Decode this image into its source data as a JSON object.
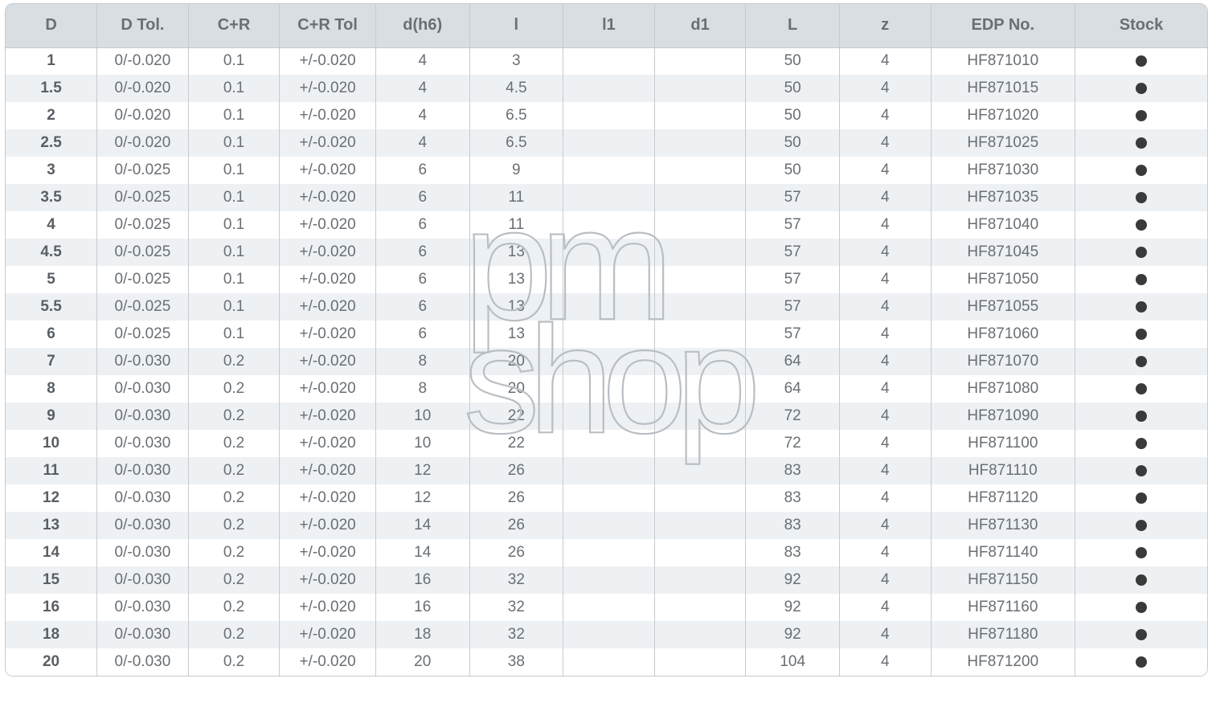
{
  "watermark": {
    "line1": "pm",
    "line2": "shop"
  },
  "table": {
    "headers": [
      "D",
      "D Tol.",
      "C+R",
      "C+R Tol",
      "d(h6)",
      "l",
      "l1",
      "d1",
      "L",
      "z",
      "EDP No.",
      "Stock"
    ],
    "rows": [
      {
        "D": "1",
        "DTol": "0/-0.020",
        "CR": "0.1",
        "CRTol": "+/-0.020",
        "dh6": "4",
        "l": "3",
        "l1": "",
        "d1": "",
        "L": "50",
        "z": "4",
        "EDP": "HF871010",
        "Stock": true
      },
      {
        "D": "1.5",
        "DTol": "0/-0.020",
        "CR": "0.1",
        "CRTol": "+/-0.020",
        "dh6": "4",
        "l": "4.5",
        "l1": "",
        "d1": "",
        "L": "50",
        "z": "4",
        "EDP": "HF871015",
        "Stock": true
      },
      {
        "D": "2",
        "DTol": "0/-0.020",
        "CR": "0.1",
        "CRTol": "+/-0.020",
        "dh6": "4",
        "l": "6.5",
        "l1": "",
        "d1": "",
        "L": "50",
        "z": "4",
        "EDP": "HF871020",
        "Stock": true
      },
      {
        "D": "2.5",
        "DTol": "0/-0.020",
        "CR": "0.1",
        "CRTol": "+/-0.020",
        "dh6": "4",
        "l": "6.5",
        "l1": "",
        "d1": "",
        "L": "50",
        "z": "4",
        "EDP": "HF871025",
        "Stock": true
      },
      {
        "D": "3",
        "DTol": "0/-0.025",
        "CR": "0.1",
        "CRTol": "+/-0.020",
        "dh6": "6",
        "l": "9",
        "l1": "",
        "d1": "",
        "L": "50",
        "z": "4",
        "EDP": "HF871030",
        "Stock": true
      },
      {
        "D": "3.5",
        "DTol": "0/-0.025",
        "CR": "0.1",
        "CRTol": "+/-0.020",
        "dh6": "6",
        "l": "11",
        "l1": "",
        "d1": "",
        "L": "57",
        "z": "4",
        "EDP": "HF871035",
        "Stock": true
      },
      {
        "D": "4",
        "DTol": "0/-0.025",
        "CR": "0.1",
        "CRTol": "+/-0.020",
        "dh6": "6",
        "l": "11",
        "l1": "",
        "d1": "",
        "L": "57",
        "z": "4",
        "EDP": "HF871040",
        "Stock": true
      },
      {
        "D": "4.5",
        "DTol": "0/-0.025",
        "CR": "0.1",
        "CRTol": "+/-0.020",
        "dh6": "6",
        "l": "13",
        "l1": "",
        "d1": "",
        "L": "57",
        "z": "4",
        "EDP": "HF871045",
        "Stock": true
      },
      {
        "D": "5",
        "DTol": "0/-0.025",
        "CR": "0.1",
        "CRTol": "+/-0.020",
        "dh6": "6",
        "l": "13",
        "l1": "",
        "d1": "",
        "L": "57",
        "z": "4",
        "EDP": "HF871050",
        "Stock": true
      },
      {
        "D": "5.5",
        "DTol": "0/-0.025",
        "CR": "0.1",
        "CRTol": "+/-0.020",
        "dh6": "6",
        "l": "13",
        "l1": "",
        "d1": "",
        "L": "57",
        "z": "4",
        "EDP": "HF871055",
        "Stock": true
      },
      {
        "D": "6",
        "DTol": "0/-0.025",
        "CR": "0.1",
        "CRTol": "+/-0.020",
        "dh6": "6",
        "l": "13",
        "l1": "",
        "d1": "",
        "L": "57",
        "z": "4",
        "EDP": "HF871060",
        "Stock": true
      },
      {
        "D": "7",
        "DTol": "0/-0.030",
        "CR": "0.2",
        "CRTol": "+/-0.020",
        "dh6": "8",
        "l": "20",
        "l1": "",
        "d1": "",
        "L": "64",
        "z": "4",
        "EDP": "HF871070",
        "Stock": true
      },
      {
        "D": "8",
        "DTol": "0/-0.030",
        "CR": "0.2",
        "CRTol": "+/-0.020",
        "dh6": "8",
        "l": "20",
        "l1": "",
        "d1": "",
        "L": "64",
        "z": "4",
        "EDP": "HF871080",
        "Stock": true
      },
      {
        "D": "9",
        "DTol": "0/-0.030",
        "CR": "0.2",
        "CRTol": "+/-0.020",
        "dh6": "10",
        "l": "22",
        "l1": "",
        "d1": "",
        "L": "72",
        "z": "4",
        "EDP": "HF871090",
        "Stock": true
      },
      {
        "D": "10",
        "DTol": "0/-0.030",
        "CR": "0.2",
        "CRTol": "+/-0.020",
        "dh6": "10",
        "l": "22",
        "l1": "",
        "d1": "",
        "L": "72",
        "z": "4",
        "EDP": "HF871100",
        "Stock": true
      },
      {
        "D": "11",
        "DTol": "0/-0.030",
        "CR": "0.2",
        "CRTol": "+/-0.020",
        "dh6": "12",
        "l": "26",
        "l1": "",
        "d1": "",
        "L": "83",
        "z": "4",
        "EDP": "HF871110",
        "Stock": true
      },
      {
        "D": "12",
        "DTol": "0/-0.030",
        "CR": "0.2",
        "CRTol": "+/-0.020",
        "dh6": "12",
        "l": "26",
        "l1": "",
        "d1": "",
        "L": "83",
        "z": "4",
        "EDP": "HF871120",
        "Stock": true
      },
      {
        "D": "13",
        "DTol": "0/-0.030",
        "CR": "0.2",
        "CRTol": "+/-0.020",
        "dh6": "14",
        "l": "26",
        "l1": "",
        "d1": "",
        "L": "83",
        "z": "4",
        "EDP": "HF871130",
        "Stock": true
      },
      {
        "D": "14",
        "DTol": "0/-0.030",
        "CR": "0.2",
        "CRTol": "+/-0.020",
        "dh6": "14",
        "l": "26",
        "l1": "",
        "d1": "",
        "L": "83",
        "z": "4",
        "EDP": "HF871140",
        "Stock": true
      },
      {
        "D": "15",
        "DTol": "0/-0.030",
        "CR": "0.2",
        "CRTol": "+/-0.020",
        "dh6": "16",
        "l": "32",
        "l1": "",
        "d1": "",
        "L": "92",
        "z": "4",
        "EDP": "HF871150",
        "Stock": true
      },
      {
        "D": "16",
        "DTol": "0/-0.030",
        "CR": "0.2",
        "CRTol": "+/-0.020",
        "dh6": "16",
        "l": "32",
        "l1": "",
        "d1": "",
        "L": "92",
        "z": "4",
        "EDP": "HF871160",
        "Stock": true
      },
      {
        "D": "18",
        "DTol": "0/-0.030",
        "CR": "0.2",
        "CRTol": "+/-0.020",
        "dh6": "18",
        "l": "32",
        "l1": "",
        "d1": "",
        "L": "92",
        "z": "4",
        "EDP": "HF871180",
        "Stock": true
      },
      {
        "D": "20",
        "DTol": "0/-0.030",
        "CR": "0.2",
        "CRTol": "+/-0.020",
        "dh6": "20",
        "l": "38",
        "l1": "",
        "d1": "",
        "L": "104",
        "z": "4",
        "EDP": "HF871200",
        "Stock": true
      }
    ]
  }
}
